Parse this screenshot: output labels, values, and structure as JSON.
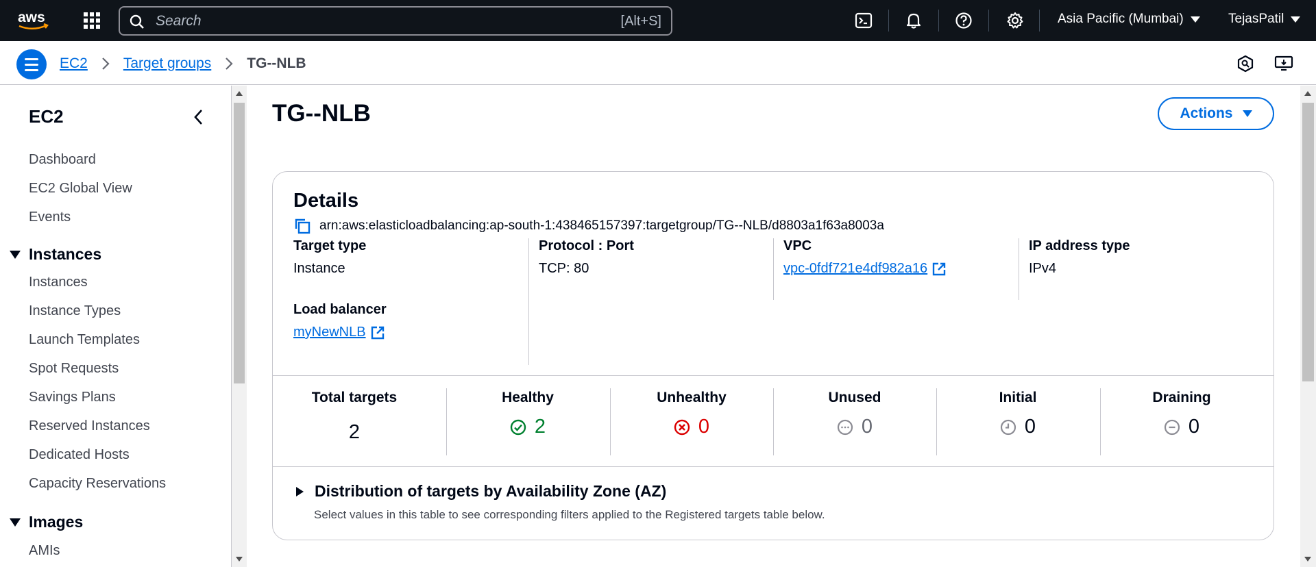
{
  "topnav": {
    "search_placeholder": "Search",
    "search_shortcut": "[Alt+S]",
    "region": "Asia Pacific (Mumbai)",
    "user": "TejasPatil",
    "icons": [
      "aws-logo",
      "services-grid-icon",
      "search-icon",
      "cloudshell-icon",
      "notifications-bell-icon",
      "help-icon",
      "settings-gear-icon"
    ]
  },
  "breadcrumb": {
    "items": [
      {
        "label": "EC2"
      },
      {
        "label": "Target groups"
      }
    ],
    "current": "TG--NLB"
  },
  "sidebar": {
    "title": "EC2",
    "top_items": [
      "Dashboard",
      "EC2 Global View",
      "Events"
    ],
    "sections": [
      {
        "label": "Instances",
        "items": [
          "Instances",
          "Instance Types",
          "Launch Templates",
          "Spot Requests",
          "Savings Plans",
          "Reserved Instances",
          "Dedicated Hosts",
          "Capacity Reservations"
        ]
      },
      {
        "label": "Images",
        "items": [
          "AMIs"
        ]
      }
    ]
  },
  "page": {
    "title": "TG--NLB",
    "actions_label": "Actions"
  },
  "details": {
    "title": "Details",
    "arn": "arn:aws:elasticloadbalancing:ap-south-1:438465157397:targetgroup/TG--NLB/d8803a1f63a8003a",
    "target_type": {
      "label": "Target type",
      "value": "Instance"
    },
    "protocol_port": {
      "label": "Protocol : Port",
      "value": "TCP: 80"
    },
    "vpc": {
      "label": "VPC",
      "value": "vpc-0fdf721e4df982a16"
    },
    "ip_type": {
      "label": "IP address type",
      "value": "IPv4"
    },
    "load_balancer": {
      "label": "Load balancer",
      "value": "myNewNLB"
    }
  },
  "stats": [
    {
      "label": "Total targets",
      "value": "2",
      "icon": "none",
      "color": "#000716"
    },
    {
      "label": "Healthy",
      "value": "2",
      "icon": "check-circle-icon",
      "color": "#00802f"
    },
    {
      "label": "Unhealthy",
      "value": "0",
      "icon": "x-circle-icon",
      "color": "#db0000"
    },
    {
      "label": "Unused",
      "value": "0",
      "icon": "ellipsis-circle-icon",
      "color": "#656871"
    },
    {
      "label": "Initial",
      "value": "0",
      "icon": "clock-circle-icon",
      "color": "#000716"
    },
    {
      "label": "Draining",
      "value": "0",
      "icon": "minus-circle-icon",
      "color": "#000716"
    }
  ],
  "distribution": {
    "title": "Distribution of targets by Availability Zone (AZ)",
    "description": "Select values in this table to see corresponding filters applied to the Registered targets table below."
  },
  "colors": {
    "link": "#006ce0",
    "topnav_bg": "#0f141a",
    "healthy": "#00802f",
    "unhealthy": "#db0000"
  }
}
